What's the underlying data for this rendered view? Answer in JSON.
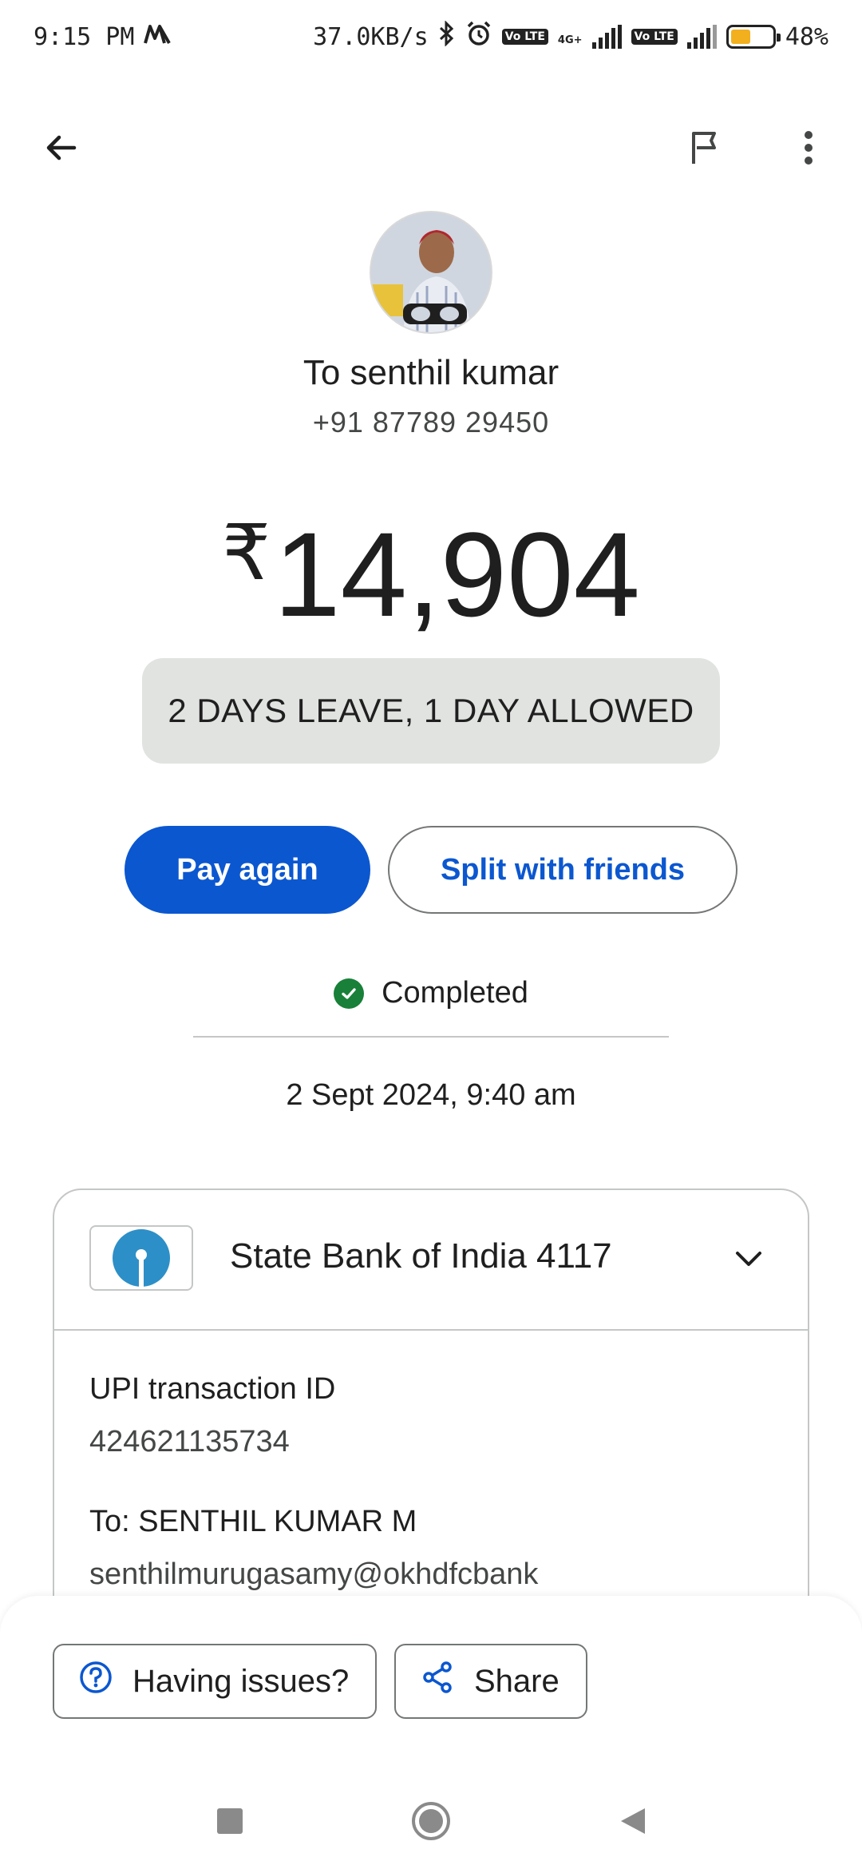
{
  "status_bar": {
    "time": "9:15 PM",
    "carrier_icon": "m-logo-icon",
    "network_speed": "37.0KB/s",
    "badge_volte_1": "Vo LTE",
    "badge_network": "4G+",
    "badge_volte_2": "Vo LTE",
    "battery_percent": "48%",
    "battery_level": 0.48
  },
  "top_bar": {
    "back_icon": "arrow-back-icon",
    "flag_icon": "flag-icon",
    "more_icon": "more-vert-icon"
  },
  "recipient": {
    "name": "To senthil kumar",
    "phone": "+91 87789 29450"
  },
  "payment": {
    "currency_symbol": "₹",
    "amount": "14,904",
    "note": "2 DAYS LEAVE, 1 DAY ALLOWED"
  },
  "actions": {
    "pay_again": "Pay again",
    "split": "Split with friends"
  },
  "status": {
    "label": "Completed",
    "date": "2 Sept 2024, 9:40 am"
  },
  "details": {
    "bank": "State Bank of India 4117",
    "txn_label": "UPI transaction ID",
    "txn_id": "424621135734",
    "to_label": "To: SENTHIL KUMAR M",
    "to_upi": "senthilmurugasamy@okhdfcbank"
  },
  "bottom_sheet": {
    "issues": "Having issues?",
    "share": "Share"
  },
  "colors": {
    "primary": "#0b57d0",
    "success": "#188038",
    "chip_bg": "#e1e3e1",
    "sbi_blue": "#2d8fc7"
  }
}
